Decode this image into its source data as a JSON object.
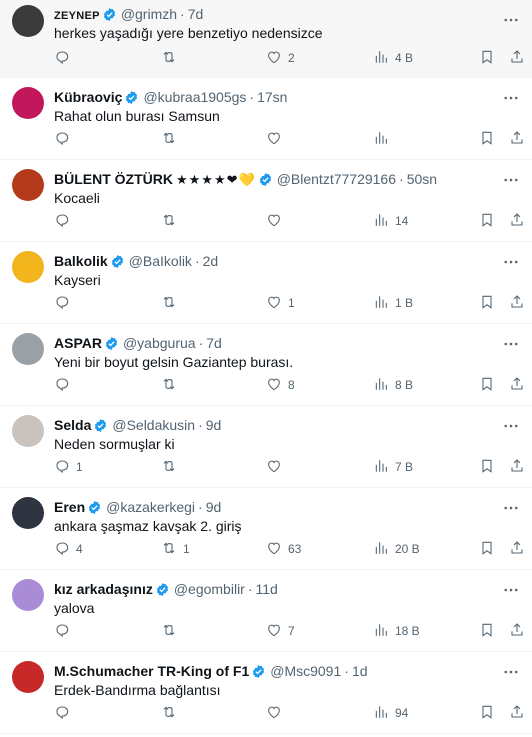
{
  "tweets": [
    {
      "name": "ZEYNEP",
      "handle": "@grimzh",
      "time": "7d",
      "text": "herkes yaşadığı yere benzetiyo nedensizce",
      "reply": "",
      "retweet": "",
      "like": "2",
      "views": "4 B",
      "avatar_color": "#3a3a3a",
      "small": true
    },
    {
      "name": "Kübraoviç",
      "handle": "@kubraa1905gs",
      "time": "17sn",
      "text": "Rahat olun burası Samsun",
      "reply": "",
      "retweet": "",
      "like": "",
      "views": "",
      "avatar_color": "#c2185b"
    },
    {
      "name": "BÜLENT ÖZTÜRK",
      "emoji": "★★★★❤💛",
      "handle": "@Blentzt77729166",
      "time": "50sn",
      "text": "Kocaeli",
      "reply": "",
      "retweet": "",
      "like": "",
      "views": "14",
      "avatar_color": "#b33a1a"
    },
    {
      "name": "Balkolik",
      "handle": "@BaIkolik",
      "time": "2d",
      "text": "Kayseri",
      "reply": "",
      "retweet": "",
      "like": "1",
      "views": "1 B",
      "avatar_color": "#f2b51b"
    },
    {
      "name": "ASPAR",
      "handle": "@yabgurua",
      "time": "7d",
      "text": "Yeni bir boyut gelsin Gaziantep burası.",
      "reply": "",
      "retweet": "",
      "like": "8",
      "views": "8 B",
      "avatar_color": "#9aa1a6"
    },
    {
      "name": "Selda",
      "handle": "@Seldakusin",
      "time": "9d",
      "text": "Neden sormuşlar ki",
      "reply": "1",
      "retweet": "",
      "like": "",
      "views": "7 B",
      "avatar_color": "#c9c2bd"
    },
    {
      "name": "Eren",
      "handle": "@kazakerkegi",
      "time": "9d",
      "text": "ankara şaşmaz kavşak 2. giriş",
      "reply": "4",
      "retweet": "1",
      "like": "63",
      "views": "20 B",
      "avatar_color": "#2e3440"
    },
    {
      "name": "kız arkadaşınız",
      "handle": "@egombilir",
      "time": "11d",
      "text": "yalova",
      "reply": "",
      "retweet": "",
      "like": "7",
      "views": "18 B",
      "avatar_color": "#a98bd6"
    },
    {
      "name": "M.Schumacher TR-King of F1",
      "handle": "@Msc9091",
      "time": "1d",
      "text": "Erdek-Bandırma bağlantısı",
      "reply": "",
      "retweet": "",
      "like": "",
      "views": "94",
      "avatar_color": "#c62828"
    }
  ],
  "colors": {
    "verified": "#1d9bf0",
    "muted": "#536471",
    "text": "#0f1419",
    "divider": "#eff3f4"
  },
  "icons": [
    "reply-icon",
    "retweet-icon",
    "like-icon",
    "views-icon",
    "bookmark-icon",
    "share-icon",
    "more-icon",
    "verified-badge-icon"
  ]
}
